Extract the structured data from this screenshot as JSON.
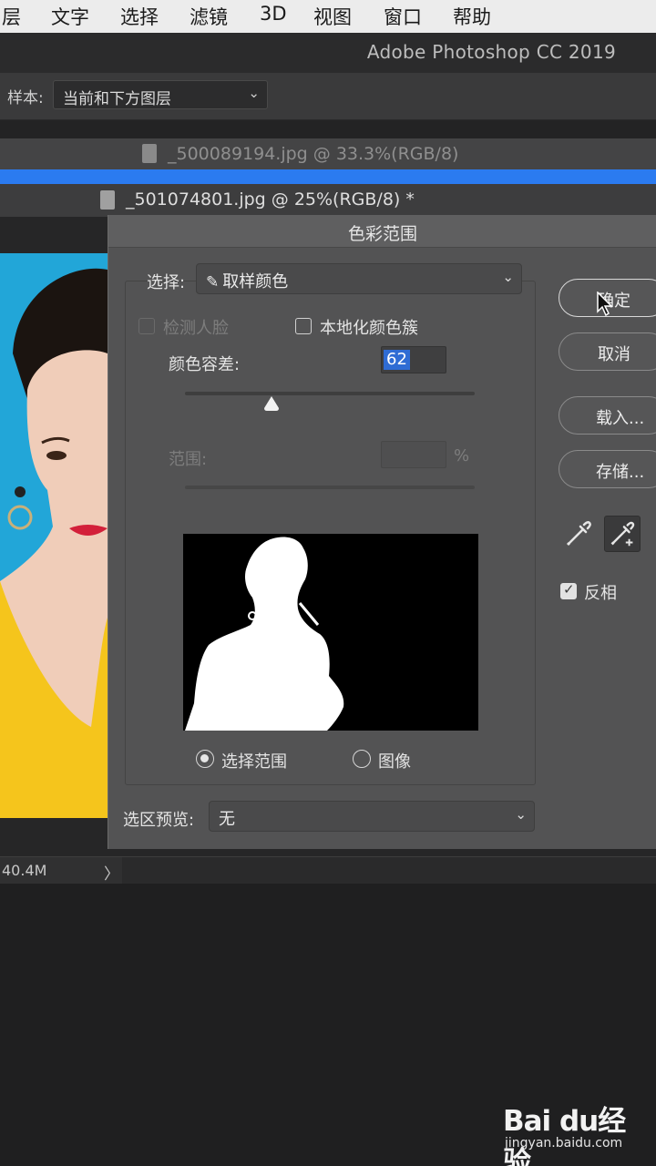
{
  "menubar": {
    "items": [
      "图层",
      "文字",
      "选择",
      "滤镜",
      "3D",
      "视图",
      "窗口",
      "帮助"
    ],
    "first_visible_fragment": "层"
  },
  "app_title": "Adobe Photoshop CC 2019",
  "options": {
    "sample_label": "样本:",
    "sample_value": "当前和下方图层"
  },
  "tabs": [
    {
      "title": "_500089194.jpg @ 33.3%(RGB/8)"
    },
    {
      "title": "_501074801.jpg @ 25%(RGB/8) *"
    }
  ],
  "status": {
    "doc_size": "40.4M",
    "arrow": "〉"
  },
  "dialog": {
    "title": "色彩范围",
    "select_label": "选择:",
    "select_value": "取样颜色",
    "detect_faces_label": "检测人脸",
    "localized_clusters_label": "本地化颜色簇",
    "fuzziness_label": "颜色容差:",
    "fuzziness_value": "62",
    "fuzziness_level": 0.3,
    "range_label": "范围:",
    "range_unit": "%",
    "radio_selection": "选择范围",
    "radio_image": "图像",
    "preview_label": "选区预览:",
    "preview_value": "无",
    "buttons": {
      "ok": "确定",
      "cancel": "取消",
      "load": "载入...",
      "save": "存储..."
    },
    "invert_label": "反相",
    "invert_checked": true,
    "localized_checked": false,
    "radio_selected": "选择范围"
  },
  "watermark": {
    "logo": "Bai du经验",
    "url": "jingyan.baidu.com"
  },
  "colors": {
    "accent_blue": "#2b7bf0",
    "highlight": "#2f6cd4",
    "photo_bg": "#22a6d8",
    "dress": "#f5c51c",
    "lips": "#d3203a"
  }
}
